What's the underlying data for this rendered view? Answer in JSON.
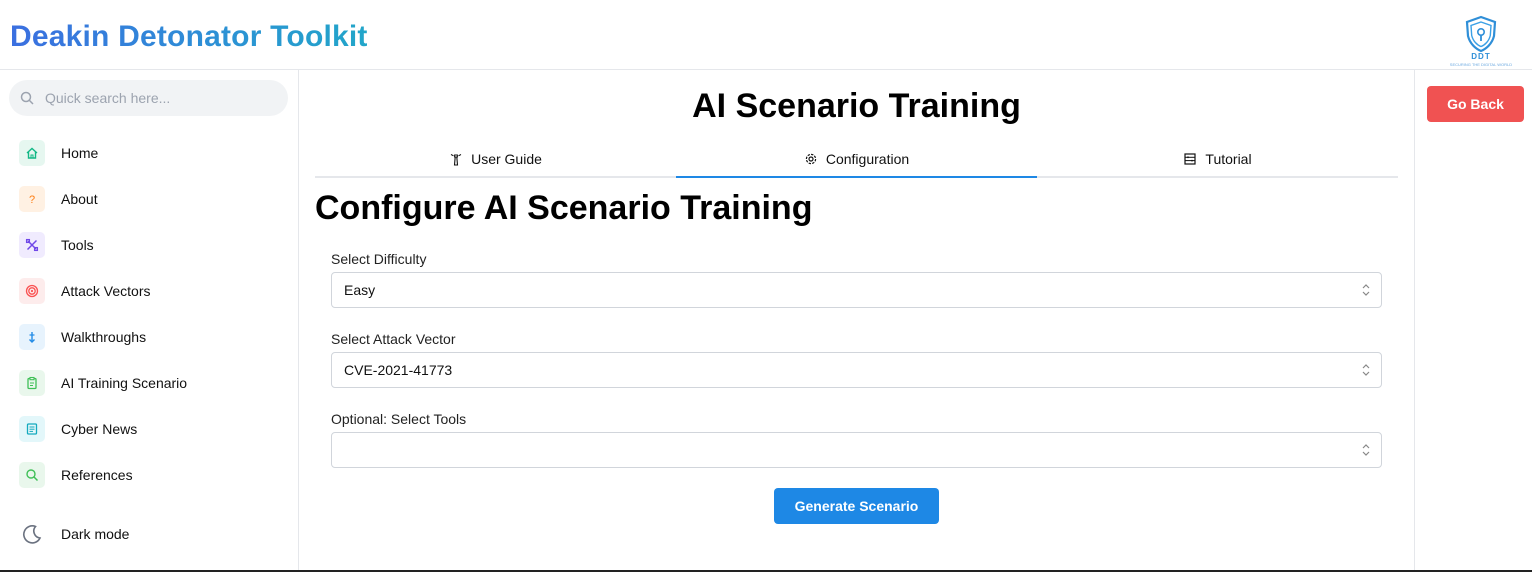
{
  "app": {
    "brand": "Deakin Detonator Toolkit",
    "logo_text": "DDT",
    "logo_sub": "SECURING THE DIGITAL WORLD"
  },
  "search": {
    "placeholder": "Quick search here..."
  },
  "sidebar": {
    "items": [
      {
        "label": "Home",
        "icon": "home-icon",
        "color": "#12b886",
        "bg": "#e6f7f0"
      },
      {
        "label": "About",
        "icon": "question-icon",
        "color": "#fd7e14",
        "bg": "#fff1e3"
      },
      {
        "label": "Tools",
        "icon": "tools-icon",
        "color": "#7048e8",
        "bg": "#f0ebfe"
      },
      {
        "label": "Attack Vectors",
        "icon": "target-icon",
        "color": "#fa5252",
        "bg": "#fdecec"
      },
      {
        "label": "Walkthroughs",
        "icon": "download-arrow-icon",
        "color": "#228be6",
        "bg": "#e7f3fd"
      },
      {
        "label": "AI Training Scenario",
        "icon": "clipboard-icon",
        "color": "#40c057",
        "bg": "#e9f7ec"
      },
      {
        "label": "Cyber News",
        "icon": "news-icon",
        "color": "#15aabf",
        "bg": "#e3f7fa"
      },
      {
        "label": "References",
        "icon": "search-icon",
        "color": "#40c057",
        "bg": "#e9f7ec"
      }
    ],
    "dark_mode_label": "Dark mode"
  },
  "main": {
    "title": "AI Scenario Training",
    "tabs": [
      {
        "label": "User Guide",
        "icon": "lighthouse-icon"
      },
      {
        "label": "Configuration",
        "icon": "gear-icon"
      },
      {
        "label": "Tutorial",
        "icon": "abacus-icon"
      }
    ],
    "section_title": "Configure AI Scenario Training",
    "difficulty": {
      "label": "Select Difficulty",
      "value": "Easy"
    },
    "attack_vector": {
      "label": "Select Attack Vector",
      "value": "CVE-2021-41773"
    },
    "tools": {
      "label": "Optional: Select Tools",
      "value": ""
    },
    "generate_label": "Generate Scenario"
  },
  "right": {
    "go_back_label": "Go Back"
  },
  "colors": {
    "accent": "#1e88e5",
    "danger": "#f05252"
  }
}
